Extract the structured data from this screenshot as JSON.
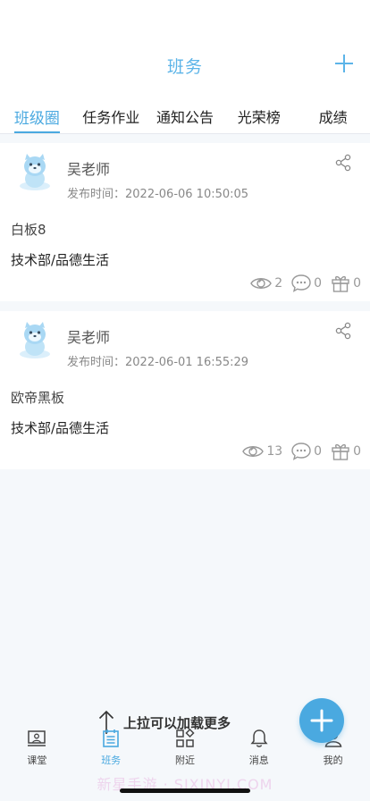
{
  "header": {
    "title": "班务"
  },
  "tabs": [
    {
      "label": "班级圈",
      "active": true
    },
    {
      "label": "任务作业",
      "active": false
    },
    {
      "label": "通知公告",
      "active": false
    },
    {
      "label": "光荣榜",
      "active": false
    },
    {
      "label": "成绩",
      "active": false
    }
  ],
  "posts": [
    {
      "author": "吴老师",
      "time": "发布时间：2022-06-06 10:50:05",
      "content": "白板8",
      "category": "技术部/品德生活",
      "views": "2",
      "comments": "0",
      "gifts": "0"
    },
    {
      "author": "吴老师",
      "time": "发布时间：2022-06-01 16:55:29",
      "content": "欧帝黑板",
      "category": "技术部/品德生活",
      "views": "13",
      "comments": "0",
      "gifts": "0"
    }
  ],
  "load_more": "上拉可以加载更多",
  "nav": [
    {
      "label": "课堂",
      "icon": "classroom-icon"
    },
    {
      "label": "班务",
      "icon": "class-affairs-icon"
    },
    {
      "label": "附近",
      "icon": "nearby-icon"
    },
    {
      "label": "消息",
      "icon": "bell-icon"
    },
    {
      "label": "我的",
      "icon": "profile-icon"
    }
  ],
  "watermark": "新星手游 · SIXINYI.COM",
  "colors": {
    "accent": "#4aa9e0",
    "title": "#5cb4e8"
  }
}
